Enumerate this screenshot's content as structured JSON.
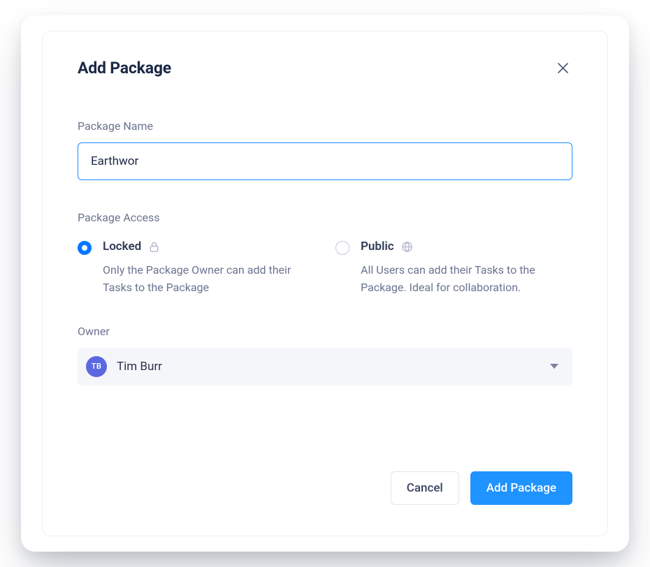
{
  "modal": {
    "title": "Add Package"
  },
  "fields": {
    "package_name": {
      "label": "Package Name",
      "value": "Earthwor"
    },
    "package_access": {
      "label": "Package Access",
      "options": {
        "locked": {
          "label": "Locked",
          "description": "Only the Package Owner can add their Tasks to the Package",
          "selected": true
        },
        "public": {
          "label": "Public",
          "description": "All Users can add their Tasks to the Package. Ideal for collaboration.",
          "selected": false
        }
      }
    },
    "owner": {
      "label": "Owner",
      "selected": {
        "initials": "TB",
        "name": "Tim Burr"
      }
    }
  },
  "buttons": {
    "cancel": "Cancel",
    "submit": "Add Package"
  }
}
